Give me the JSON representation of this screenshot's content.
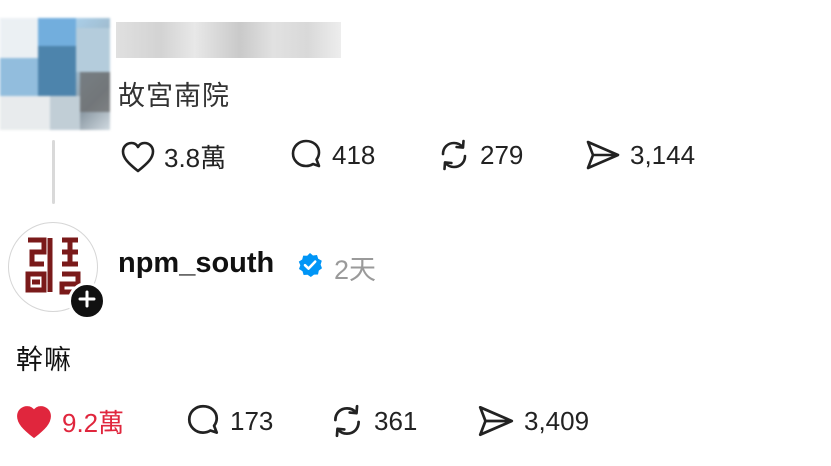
{
  "post1": {
    "text": "故宮南院",
    "actions": {
      "likes": "3.8萬",
      "replies": "418",
      "reposts": "279",
      "shares": "3,144"
    }
  },
  "post2": {
    "username": "npm_south",
    "time": "2天",
    "text": "幹嘛",
    "actions": {
      "likes": "9.2萬",
      "replies": "173",
      "reposts": "361",
      "shares": "3,409"
    },
    "liked": true
  },
  "colors": {
    "like_red": "#e0263d",
    "verified_blue": "#0095f6",
    "logo_red": "#7a1a1a"
  },
  "icons": [
    "heart-icon",
    "comment-icon",
    "repost-icon",
    "share-icon",
    "verified-badge-icon",
    "plus-icon"
  ]
}
